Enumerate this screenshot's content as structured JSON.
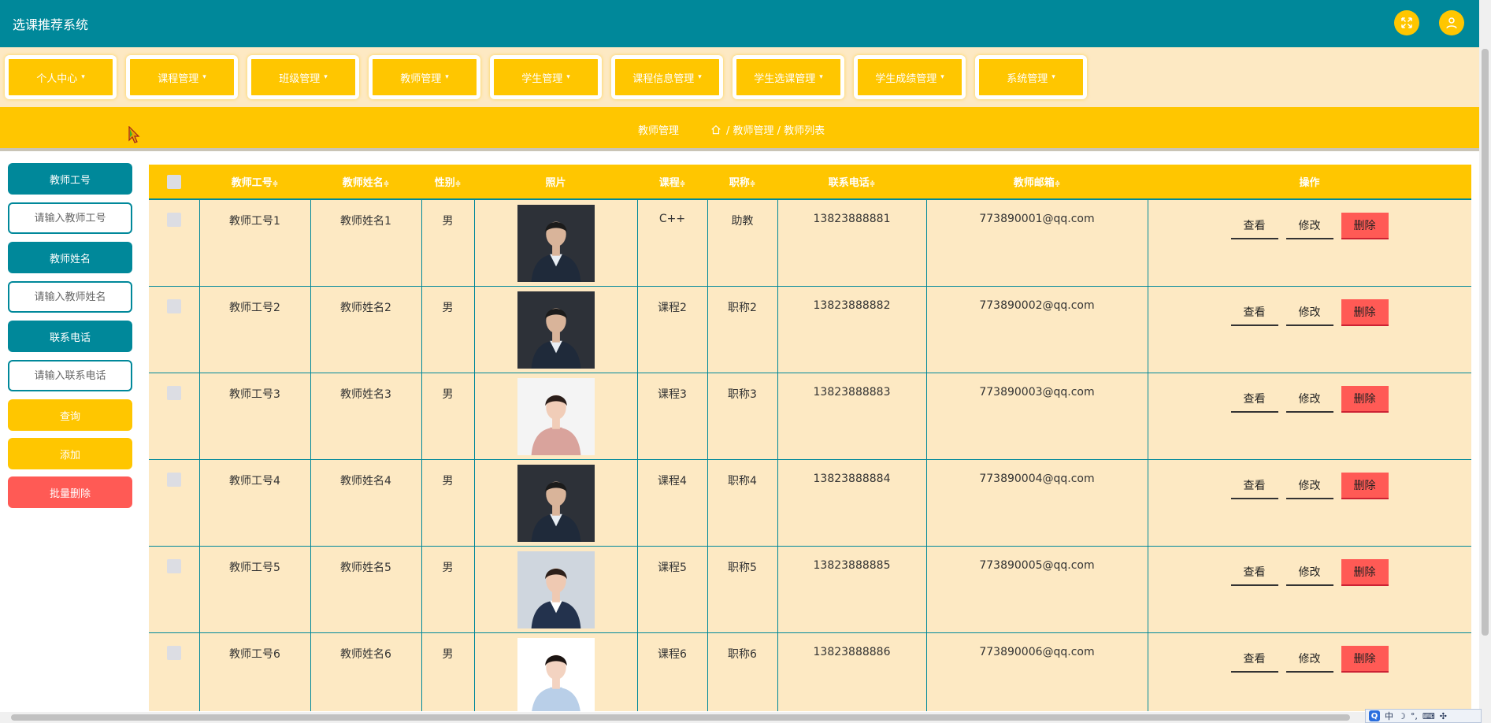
{
  "app": {
    "title": "选课推荐系统"
  },
  "header": {
    "fullscreen_icon": "fullscreen-icon",
    "user_icon": "user-icon"
  },
  "nav": {
    "items": [
      {
        "label": "个人中心"
      },
      {
        "label": "课程管理"
      },
      {
        "label": "班级管理"
      },
      {
        "label": "教师管理"
      },
      {
        "label": "学生管理"
      },
      {
        "label": "课程信息管理"
      },
      {
        "label": "学生选课管理"
      },
      {
        "label": "学生成绩管理"
      },
      {
        "label": "系统管理"
      }
    ],
    "caret": "▾"
  },
  "breadcrumb": {
    "page_title": "教师管理",
    "path": "/ 教师管理 / 教师列表"
  },
  "search": {
    "teacher_id_label": "教师工号",
    "teacher_id_placeholder": "请输入教师工号",
    "teacher_name_label": "教师姓名",
    "teacher_name_placeholder": "请输入教师姓名",
    "phone_label": "联系电话",
    "phone_placeholder": "请输入联系电话",
    "query_label": "查询",
    "add_label": "添加",
    "batch_delete_label": "批量删除"
  },
  "table": {
    "columns": [
      "教师工号",
      "教师姓名",
      "性别",
      "照片",
      "课程",
      "职称",
      "联系电话",
      "教师邮箱",
      "操作"
    ],
    "sort_glyph": "≑",
    "rows": [
      {
        "id": "教师工号1",
        "name": "教师姓名1",
        "gender": "男",
        "course": "C++",
        "title": "助教",
        "phone": "13823888881",
        "email": "773890001@qq.com",
        "photo": "male-dark-suit"
      },
      {
        "id": "教师工号2",
        "name": "教师姓名2",
        "gender": "男",
        "course": "课程2",
        "title": "职称2",
        "phone": "13823888882",
        "email": "773890002@qq.com",
        "photo": "male-dark-suit"
      },
      {
        "id": "教师工号3",
        "name": "教师姓名3",
        "gender": "男",
        "course": "课程3",
        "title": "职称3",
        "phone": "13823888883",
        "email": "773890003@qq.com",
        "photo": "female-pink-blouse"
      },
      {
        "id": "教师工号4",
        "name": "教师姓名4",
        "gender": "男",
        "course": "课程4",
        "title": "职称4",
        "phone": "13823888884",
        "email": "773890004@qq.com",
        "photo": "male-dark-suit"
      },
      {
        "id": "教师工号5",
        "name": "教师姓名5",
        "gender": "男",
        "course": "课程5",
        "title": "职称5",
        "phone": "13823888885",
        "email": "773890005@qq.com",
        "photo": "female-navy-suit"
      },
      {
        "id": "教师工号6",
        "name": "教师姓名6",
        "gender": "男",
        "course": "课程6",
        "title": "职称6",
        "phone": "13823888886",
        "email": "773890006@qq.com",
        "photo": "female-light-blue"
      }
    ],
    "ops": {
      "view": "查看",
      "edit": "修改",
      "delete": "删除"
    }
  },
  "ime": {
    "label": "中"
  },
  "colors": {
    "teal": "#00889a",
    "yellow": "#ffc600",
    "cream": "#fde9c3",
    "red": "#ff5a55"
  }
}
